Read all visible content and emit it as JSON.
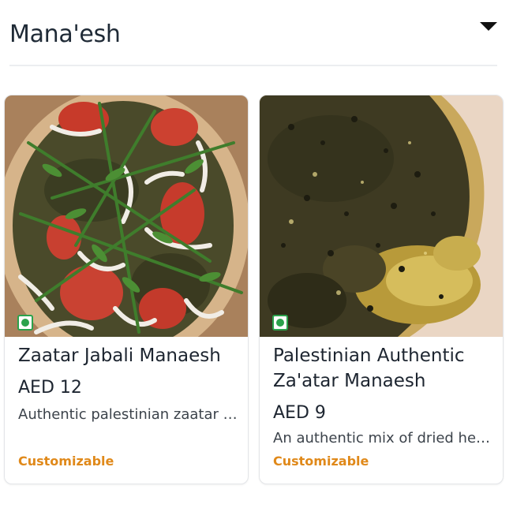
{
  "section": {
    "title": "Mana'esh",
    "toggle_icon": "caret-down-icon"
  },
  "items": [
    {
      "name": "Zaatar Jabali Manaesh",
      "price": "AED 12",
      "description": "Authentic palestinian zaatar with tomato, onion and fresh herbs",
      "tag": "Customizable",
      "diet_icon": "veg-indicator-icon"
    },
    {
      "name": "Palestinian Authentic Za'atar Manaesh",
      "price": "AED 9",
      "description": "An authentic mix of dried herbs, sesame and olive oil",
      "tag": "Customizable",
      "diet_icon": "veg-indicator-icon"
    }
  ],
  "colors": {
    "accent": "#e0891a",
    "veg": "#2ba24c",
    "text": "#1d2530"
  }
}
